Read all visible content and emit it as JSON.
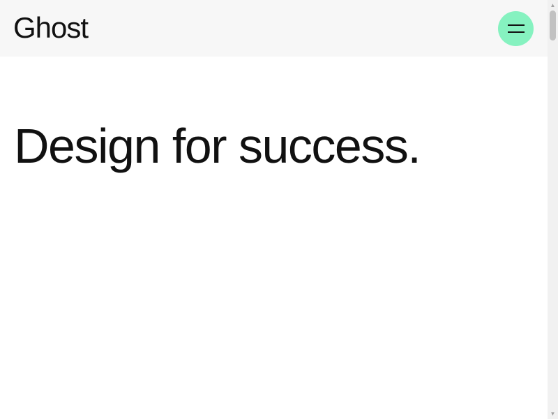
{
  "brand": {
    "logo_text": "Ghost"
  },
  "header": {
    "menu_icon": "hamburger-icon",
    "menu_button_color": "#86f2c0",
    "background": "#f7f7f7"
  },
  "main": {
    "headline": "Design for success."
  },
  "scrollbar": {
    "up_icon": "triangle-up-icon",
    "down_icon": "triangle-down-icon"
  }
}
